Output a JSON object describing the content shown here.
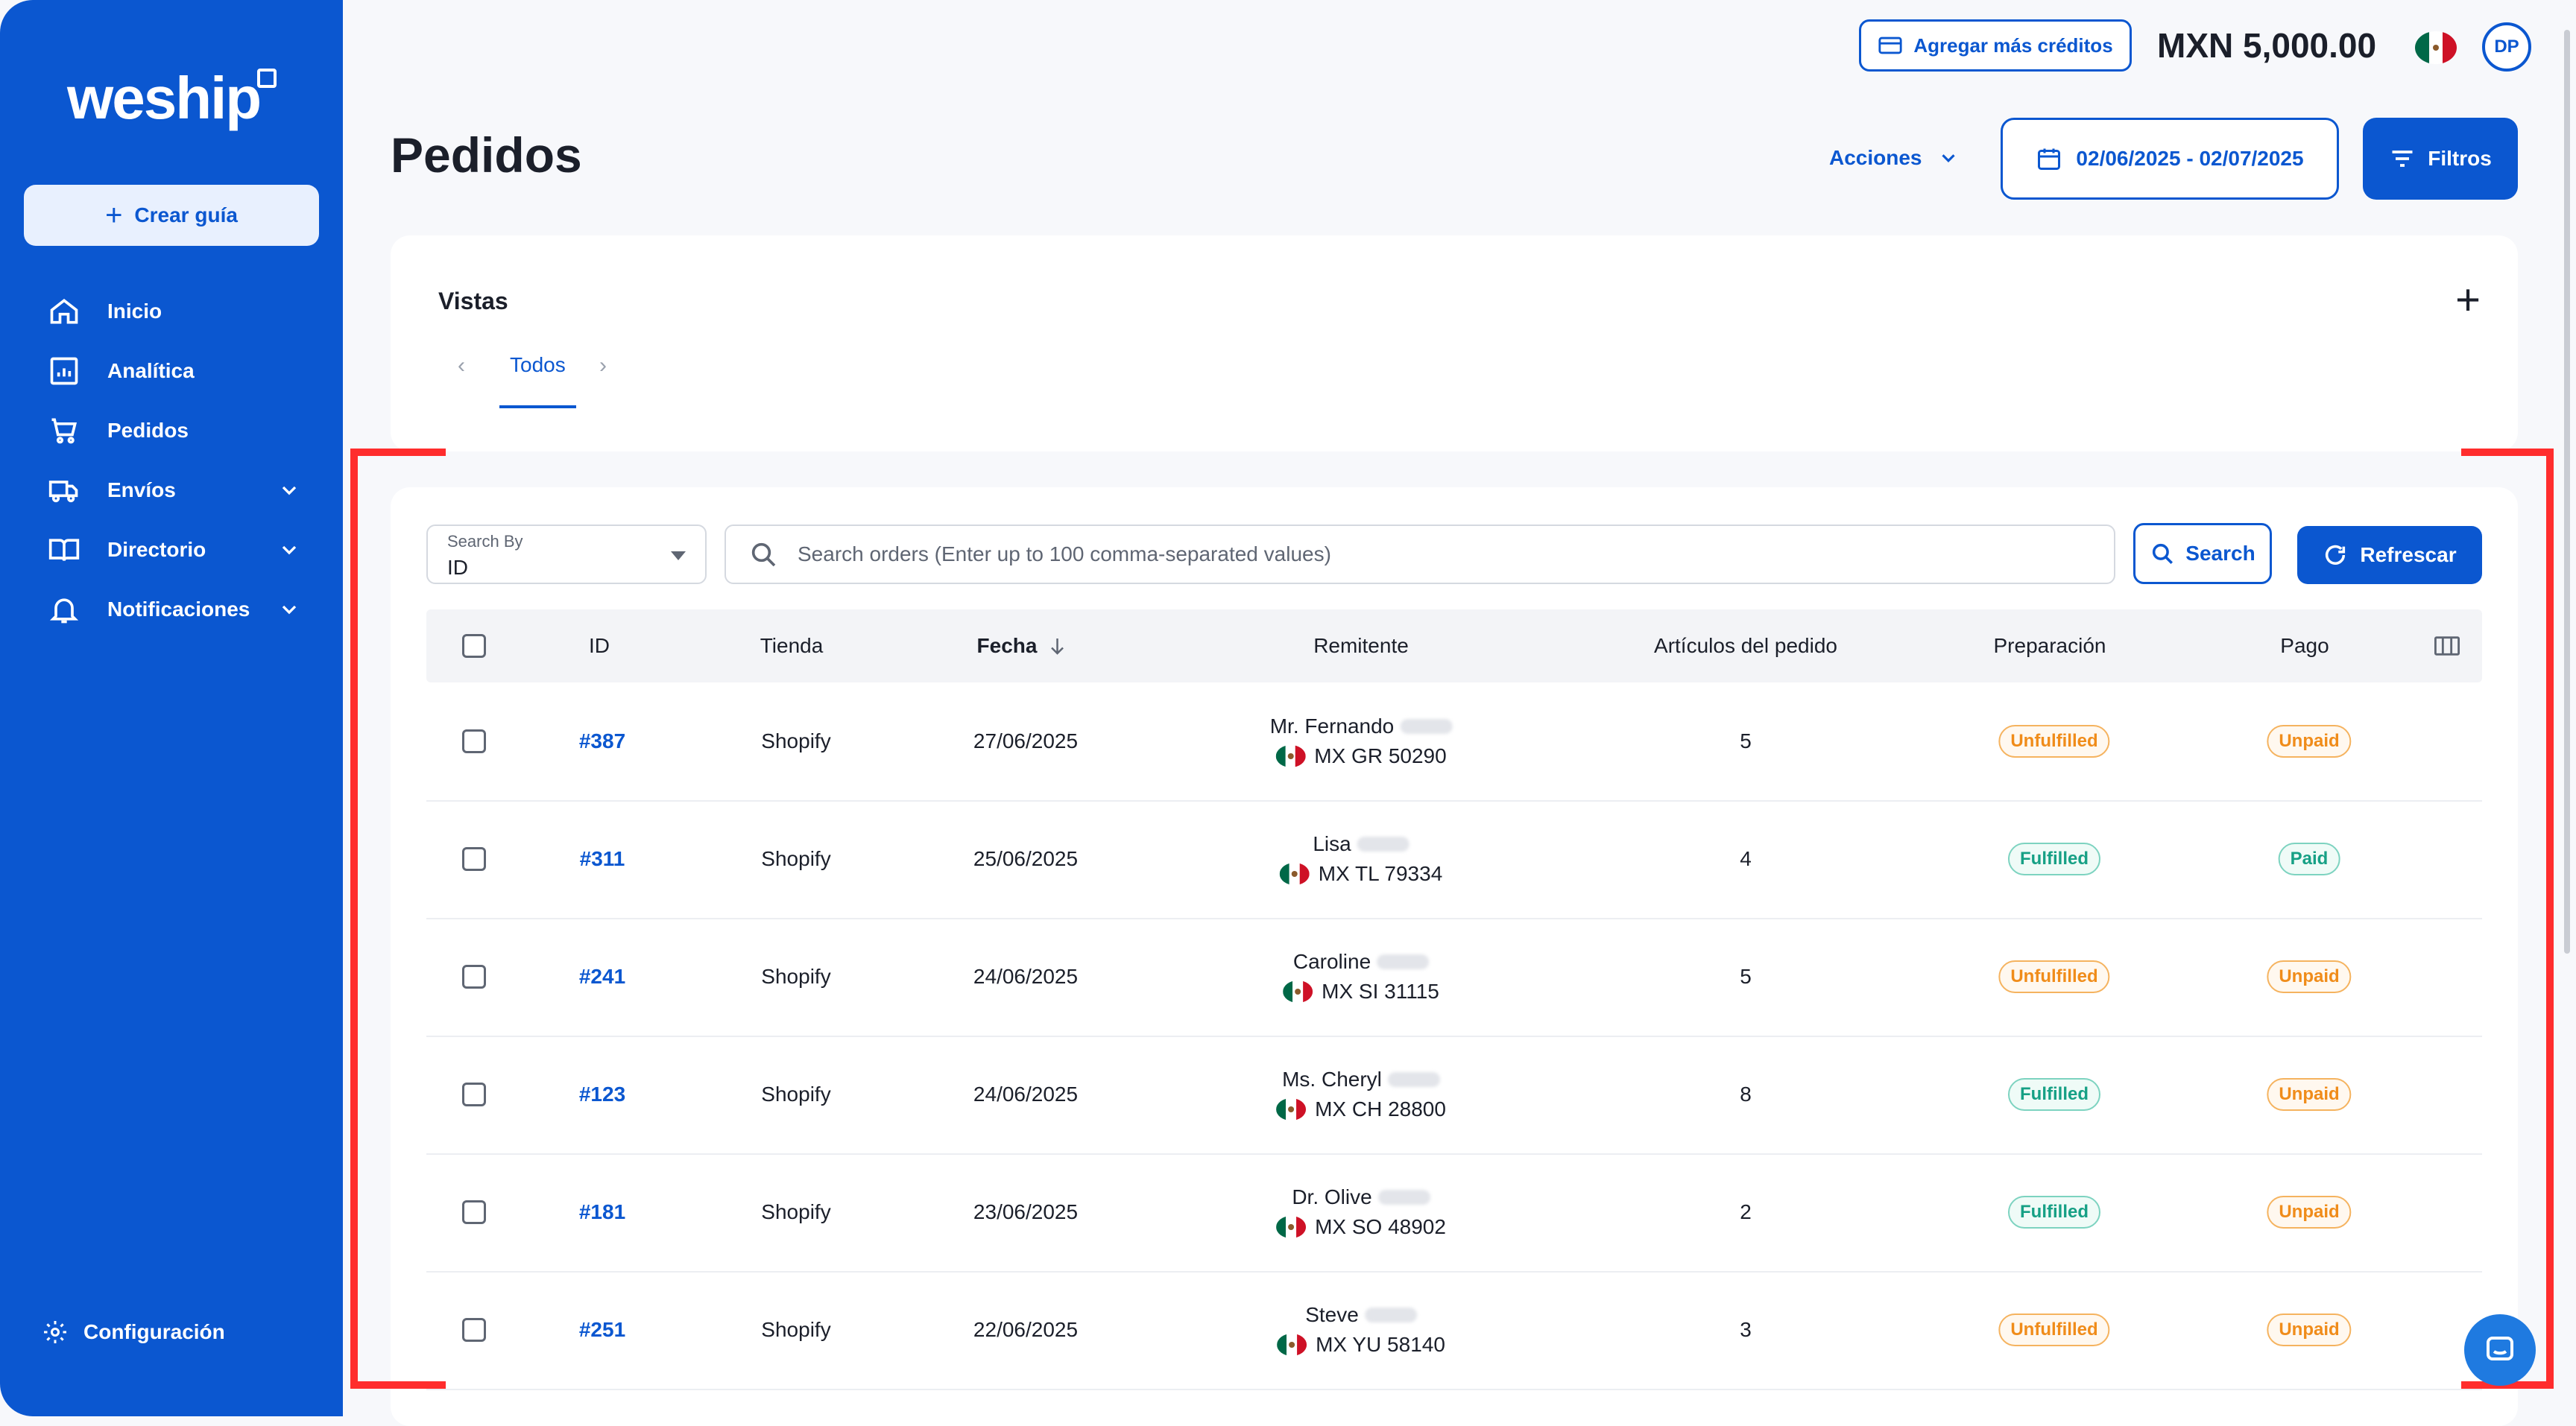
{
  "sidebar": {
    "logo": "weship",
    "create_button": "Crear guía",
    "items": [
      {
        "label": "Inicio",
        "icon": "home-icon",
        "has_chevron": false
      },
      {
        "label": "Analítica",
        "icon": "chart-icon",
        "has_chevron": false
      },
      {
        "label": "Pedidos",
        "icon": "cart-icon",
        "has_chevron": false
      },
      {
        "label": "Envíos",
        "icon": "truck-icon",
        "has_chevron": true
      },
      {
        "label": "Directorio",
        "icon": "book-icon",
        "has_chevron": true
      },
      {
        "label": "Notificaciones",
        "icon": "bell-icon",
        "has_chevron": true
      }
    ],
    "config_label": "Configuración"
  },
  "topbar": {
    "credits_button": "Agregar más créditos",
    "balance": "MXN 5,000.00",
    "avatar_initials": "DP"
  },
  "header": {
    "title": "Pedidos",
    "actions_label": "Acciones",
    "date_range": "02/06/2025 - 02/07/2025",
    "filters_label": "Filtros"
  },
  "views": {
    "title": "Vistas",
    "tabs": [
      "Todos"
    ]
  },
  "search": {
    "by_label": "Search By",
    "by_value": "ID",
    "placeholder": "Search orders (Enter up to 100 comma-separated values)",
    "search_button": "Search",
    "refresh_button": "Refrescar"
  },
  "table": {
    "columns": [
      "ID",
      "Tienda",
      "Fecha",
      "Remitente",
      "Artículos del pedido",
      "Preparación",
      "Pago"
    ],
    "rows": [
      {
        "id": "#387",
        "store": "Shopify",
        "date": "27/06/2025",
        "sender_name": "Mr. Fernando",
        "sender_addr": "MX GR 50290",
        "items": "5",
        "prep": "Unfulfilled",
        "payment": "Unpaid"
      },
      {
        "id": "#311",
        "store": "Shopify",
        "date": "25/06/2025",
        "sender_name": "Lisa",
        "sender_addr": "MX TL 79334",
        "items": "4",
        "prep": "Fulfilled",
        "payment": "Paid"
      },
      {
        "id": "#241",
        "store": "Shopify",
        "date": "24/06/2025",
        "sender_name": "Caroline",
        "sender_addr": "MX SI 31115",
        "items": "5",
        "prep": "Unfulfilled",
        "payment": "Unpaid"
      },
      {
        "id": "#123",
        "store": "Shopify",
        "date": "24/06/2025",
        "sender_name": "Ms. Cheryl",
        "sender_addr": "MX CH 28800",
        "items": "8",
        "prep": "Fulfilled",
        "payment": "Unpaid"
      },
      {
        "id": "#181",
        "store": "Shopify",
        "date": "23/06/2025",
        "sender_name": "Dr. Olive",
        "sender_addr": "MX SO 48902",
        "items": "2",
        "prep": "Fulfilled",
        "payment": "Unpaid"
      },
      {
        "id": "#251",
        "store": "Shopify",
        "date": "22/06/2025",
        "sender_name": "Steve",
        "sender_addr": "MX YU 58140",
        "items": "3",
        "prep": "Unfulfilled",
        "payment": "Unpaid"
      }
    ]
  },
  "colors": {
    "brand": "#0b57d0",
    "unfulfilled": "#f08c1a",
    "fulfilled": "#16a085",
    "annotation": "#ff2d2d"
  }
}
